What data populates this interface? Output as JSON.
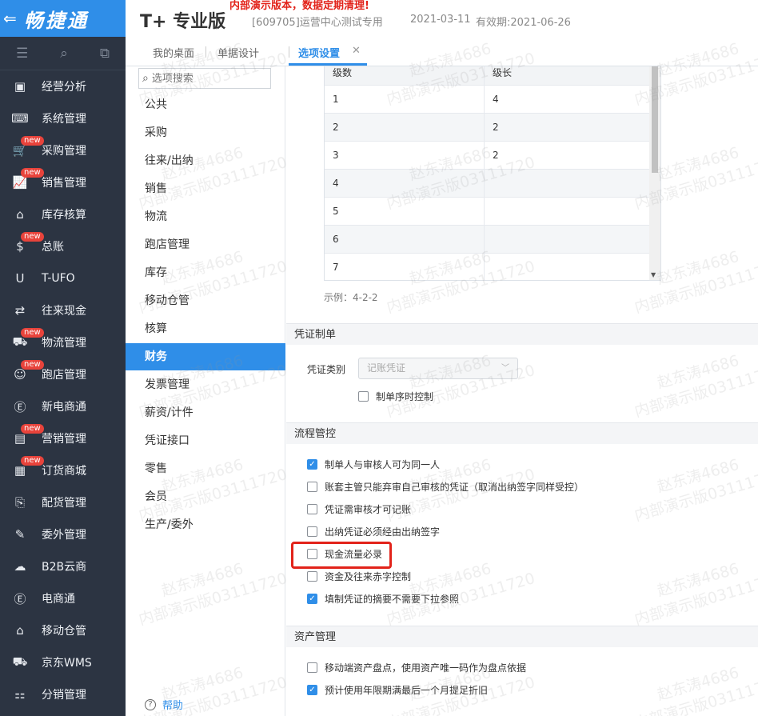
{
  "brand": {
    "name": "畅捷通",
    "back_icon": "arrow-left-icon"
  },
  "header": {
    "product": "T+ 专业版",
    "warning": "内部演示版本，数据定期清理!",
    "account": "[609705]运营中心测试专用",
    "date": "2021-03-11",
    "validity": "有效期:2021-06-26"
  },
  "nav": {
    "items": [
      {
        "label": "经营分析",
        "icon": "monitor-chart-icon",
        "badge": ""
      },
      {
        "label": "系统管理",
        "icon": "code-window-icon",
        "badge": ""
      },
      {
        "label": "采购管理",
        "icon": "cart-icon",
        "badge": "new"
      },
      {
        "label": "销售管理",
        "icon": "sales-chart-icon",
        "badge": "new"
      },
      {
        "label": "库存核算",
        "icon": "warehouse-icon",
        "badge": ""
      },
      {
        "label": "总账",
        "icon": "ledger-icon",
        "badge": "new"
      },
      {
        "label": "T-UFO",
        "icon": "ufo-icon",
        "badge": ""
      },
      {
        "label": "往来现金",
        "icon": "exchange-icon",
        "badge": ""
      },
      {
        "label": "物流管理",
        "icon": "truck-icon",
        "badge": "new"
      },
      {
        "label": "跑店管理",
        "icon": "store-person-icon",
        "badge": "new"
      },
      {
        "label": "新电商通",
        "icon": "ecommerce-icon",
        "badge": ""
      },
      {
        "label": "营销管理",
        "icon": "marketing-icon",
        "badge": "new"
      },
      {
        "label": "订货商城",
        "icon": "mall-icon",
        "badge": "new"
      },
      {
        "label": "配货管理",
        "icon": "distribution-icon",
        "badge": ""
      },
      {
        "label": "委外管理",
        "icon": "outsource-icon",
        "badge": ""
      },
      {
        "label": "B2B云商",
        "icon": "cloud-shop-icon",
        "badge": ""
      },
      {
        "label": "电商通",
        "icon": "e-circle-icon",
        "badge": ""
      },
      {
        "label": "移动仓管",
        "icon": "mobile-warehouse-icon",
        "badge": ""
      },
      {
        "label": "京东WMS",
        "icon": "jd-truck-icon",
        "badge": ""
      },
      {
        "label": "分销管理",
        "icon": "hierarchy-icon",
        "badge": ""
      }
    ]
  },
  "tabs": [
    {
      "label": "我的桌面"
    },
    {
      "label": "单据设计"
    },
    {
      "label": "选项设置"
    }
  ],
  "options": {
    "search_placeholder": "选项搜索",
    "items": [
      "公共",
      "采购",
      "往来/出纳",
      "销售",
      "物流",
      "跑店管理",
      "库存",
      "移动仓管",
      "核算",
      "财务",
      "发票管理",
      "薪资/计件",
      "凭证接口",
      "零售",
      "会员",
      "生产/委外"
    ],
    "active": "财务",
    "help": "帮助"
  },
  "grid": {
    "headers": [
      "级数",
      "级长"
    ],
    "rows": [
      [
        "1",
        "4"
      ],
      [
        "2",
        "2"
      ],
      [
        "3",
        "2"
      ],
      [
        "4",
        ""
      ],
      [
        "5",
        ""
      ],
      [
        "6",
        ""
      ],
      [
        "7",
        ""
      ]
    ],
    "example": "示例：4-2-2"
  },
  "voucher": {
    "section": "凭证制单",
    "type_label": "凭证类别",
    "type_value": "记账凭证",
    "seq_control": "制单序时控制"
  },
  "flow": {
    "section": "流程管控",
    "items": [
      {
        "label": "制单人与审核人可为同一人",
        "checked": true
      },
      {
        "label": "账套主管只能弃审自己审核的凭证（取消出纳签字同样受控）",
        "checked": false
      },
      {
        "label": "凭证需审核才可记账",
        "checked": false
      },
      {
        "label": "出纳凭证必须经由出纳签字",
        "checked": false
      },
      {
        "label": "现金流量必录",
        "checked": false
      },
      {
        "label": "资金及往来赤字控制",
        "checked": false
      },
      {
        "label": "填制凭证的摘要不需要下拉参照",
        "checked": true
      }
    ]
  },
  "assets": {
    "section": "资产管理",
    "items": [
      {
        "label": "移动端资产盘点，使用资产唯一码作为盘点依据",
        "checked": false
      },
      {
        "label": "预计使用年限期满最后一个月提足折旧",
        "checked": true
      }
    ]
  },
  "watermark": {
    "line1": "赵东涛4686",
    "line2": "内部演示版03111720"
  },
  "colors": {
    "accent": "#2f8ee8",
    "nav_bg": "#2c3442",
    "badge": "#e8433b",
    "highlight": "#e2231a"
  }
}
